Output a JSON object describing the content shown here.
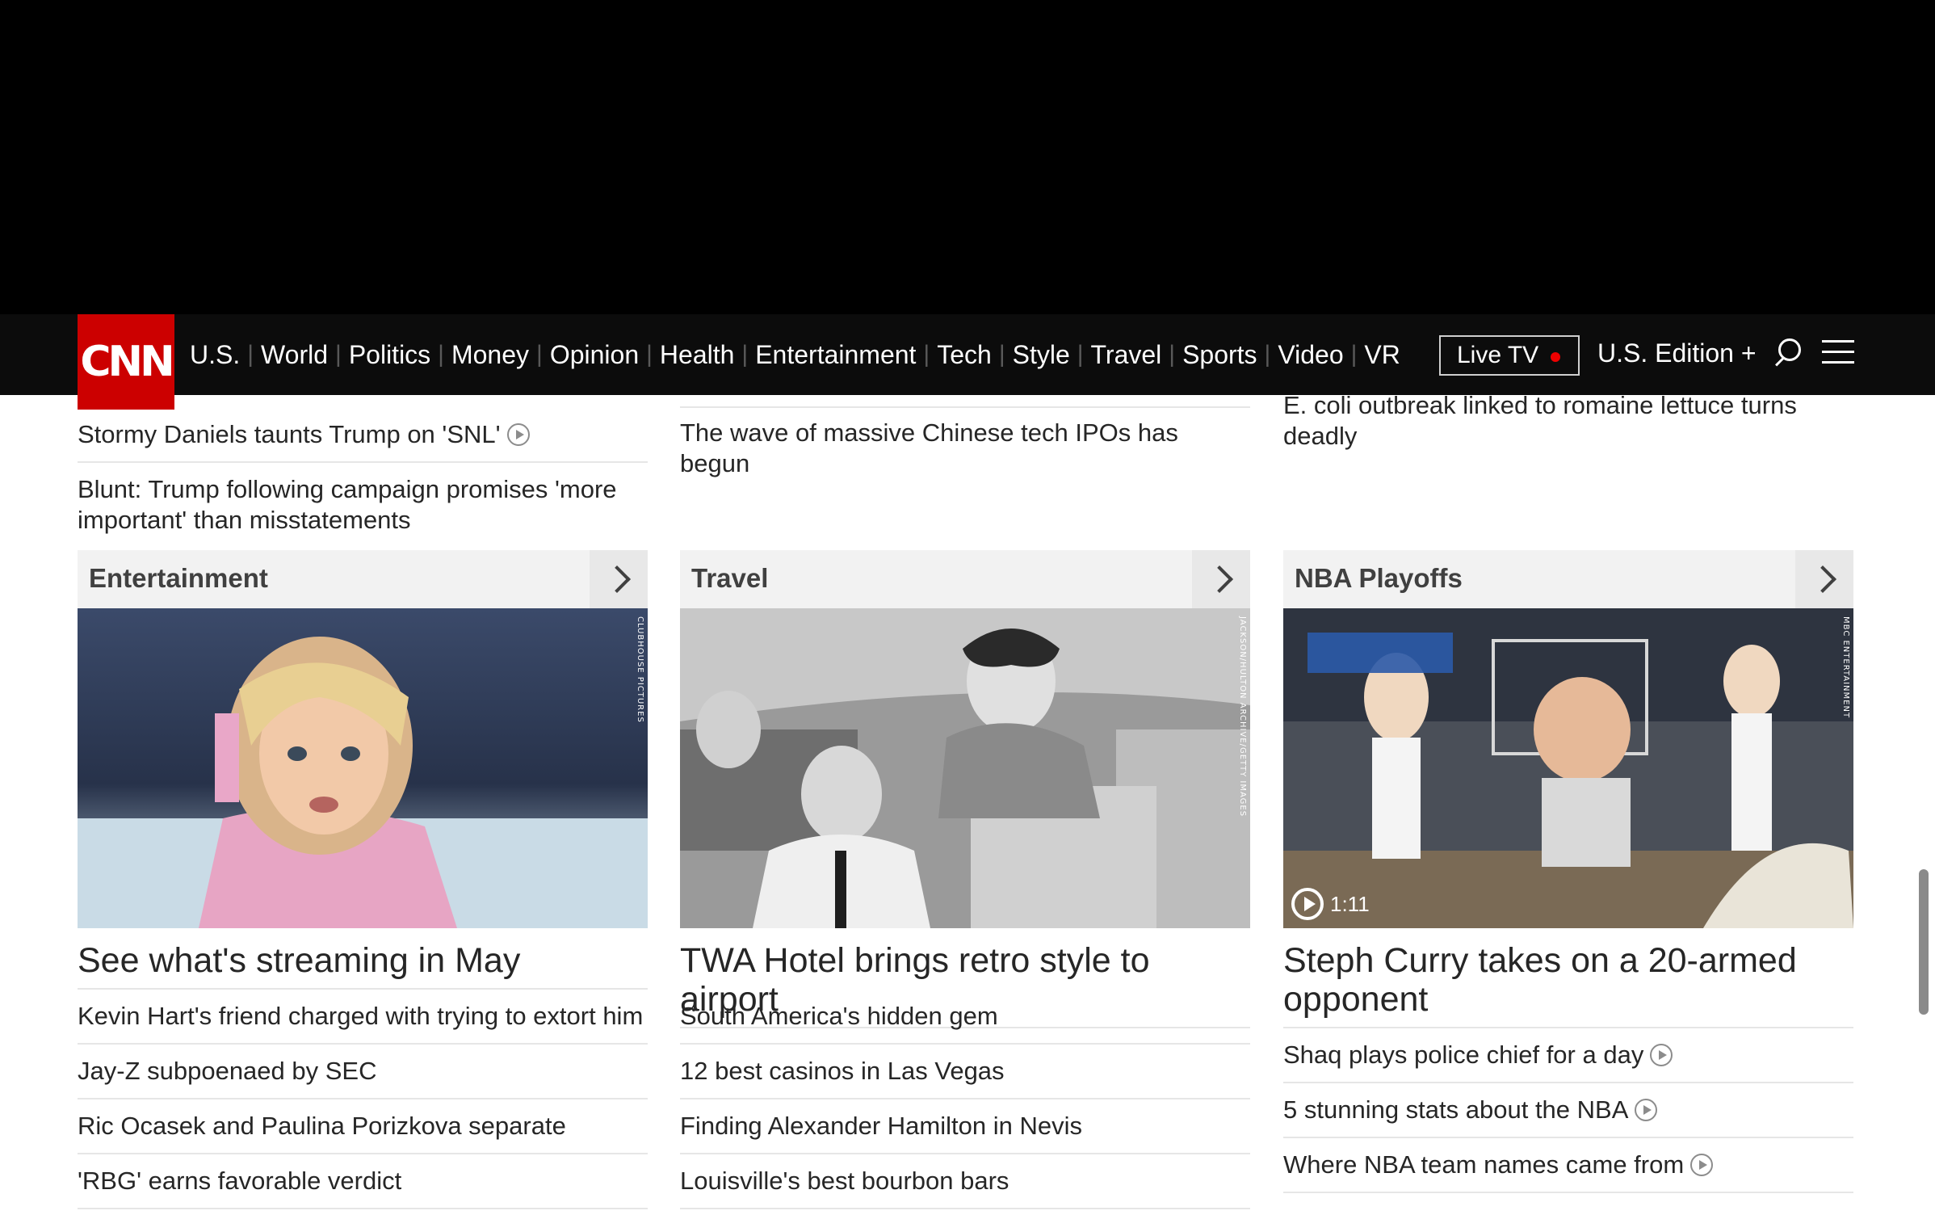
{
  "nav": {
    "logo": "CNN",
    "links": [
      "U.S.",
      "World",
      "Politics",
      "Money",
      "Opinion",
      "Health",
      "Entertainment",
      "Tech",
      "Style",
      "Travel",
      "Sports",
      "Video",
      "VR"
    ],
    "live_tv": "Live TV",
    "edition": "U.S. Edition +"
  },
  "top_headlines": {
    "col1": [
      "Stormy Daniels taunts Trump on 'SNL'",
      "Blunt: Trump following campaign promises 'more important' than misstatements"
    ],
    "col2": [
      "The wave of massive Chinese tech IPOs has begun"
    ],
    "col3": [
      "E. coli outbreak linked to romaine lettuce turns deadly"
    ]
  },
  "sections": [
    {
      "title": "Entertainment",
      "image_credit": "CLUBHOUSE PICTURES",
      "headline": "See what's streaming in May",
      "items": [
        "Kevin Hart's friend charged with trying to extort him",
        "Jay-Z subpoenaed by SEC",
        "Ric Ocasek and Paulina Porizkova separate",
        "'RBG' earns favorable verdict"
      ]
    },
    {
      "title": "Travel",
      "image_credit": "JACKSON/HULTON ARCHIVE/GETTY IMAGES",
      "headline": "TWA Hotel brings retro style to airport",
      "items": [
        "South America's hidden gem",
        "12 best casinos in Las Vegas",
        "Finding Alexander Hamilton in Nevis",
        "Louisville's best bourbon bars"
      ]
    },
    {
      "title": "NBA Playoffs",
      "image_credit": "MBC ENTERTAINMENT",
      "video_duration": "1:11",
      "headline": "Steph Curry takes on a 20-armed opponent",
      "items": [
        "Shaq plays police chief for a day",
        "5 stunning stats about the NBA",
        "Where NBA team names came from"
      ]
    }
  ],
  "colors": {
    "brand_red": "#cc0000",
    "nav_bg": "#0c0c0c"
  }
}
